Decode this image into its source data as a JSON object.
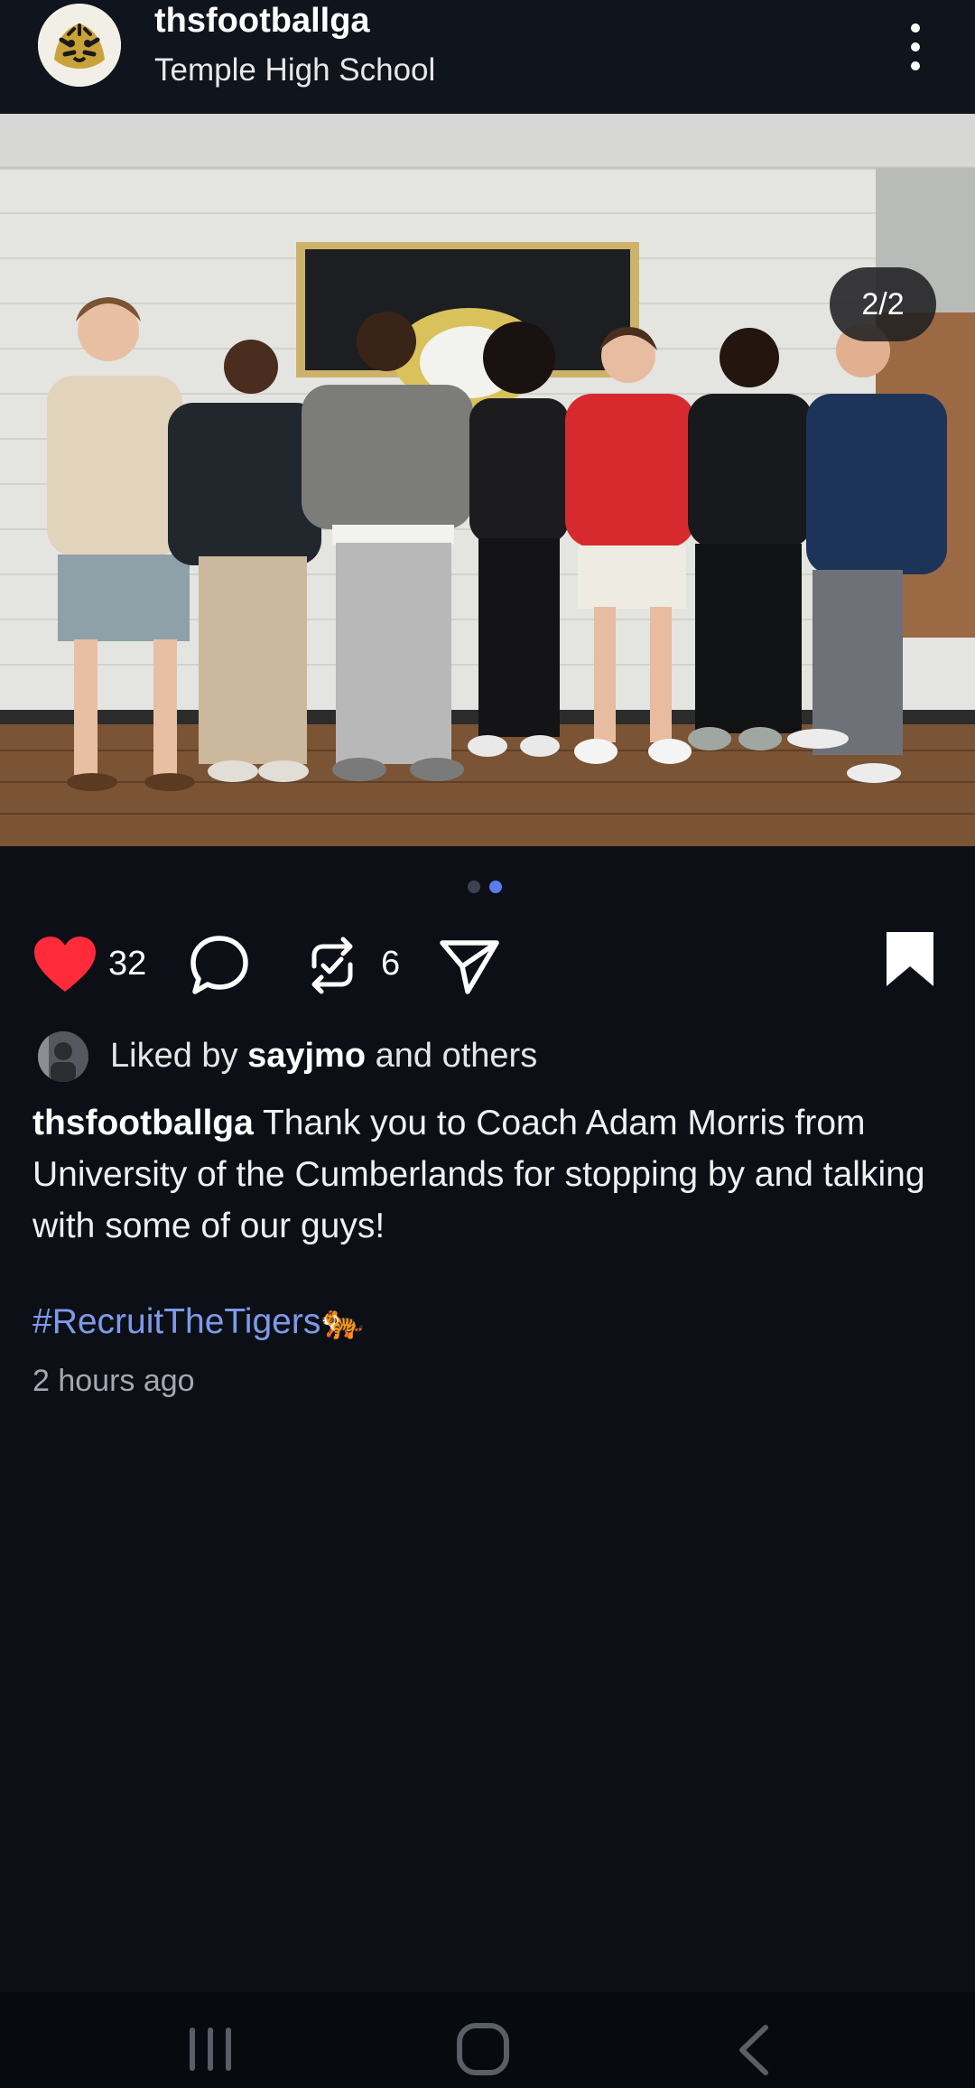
{
  "header": {
    "username": "thsfootballga",
    "location": "Temple High School",
    "more_icon": "vertical-dots-icon"
  },
  "post": {
    "image_counter": "2/2",
    "carousel": {
      "total": 2,
      "active_index": 2
    },
    "likes_count": "32",
    "reposts_count": "6",
    "liked_by_prefix": "Liked by ",
    "liked_by_user": "sayjmo",
    "liked_by_suffix": " and others",
    "caption_user": "thsfootballga",
    "caption_text": " Thank you to Coach Adam Morris from University of the Cumberlands for stopping by and talking with some of our guys!",
    "hashtag": "#RecruitTheTigers",
    "hashtag_emoji": "🐅",
    "timestamp": "2 hours ago"
  },
  "colors": {
    "background": "#0c0f16",
    "header": "#10141c",
    "heart": "#ff2a3a",
    "hashtag": "#7e9ae8",
    "active_dot": "#5a7cf0",
    "inactive_dot": "#3c4350"
  },
  "icons": {
    "like": "heart-icon",
    "comment": "comment-bubble-icon",
    "repost": "repost-icon",
    "share": "send-icon",
    "save": "bookmark-icon",
    "nav_recents": "recents-icon",
    "nav_home": "home-icon",
    "nav_back": "back-icon"
  }
}
